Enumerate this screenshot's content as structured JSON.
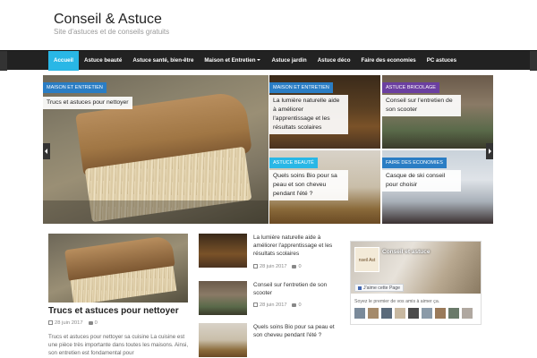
{
  "header": {
    "site_title": "Conseil & Astuce",
    "tagline": "Site d'astuces et de conseils gratuits"
  },
  "nav": {
    "items": [
      {
        "label": "Accueil",
        "active": true
      },
      {
        "label": "Astuce beauté"
      },
      {
        "label": "Astuce santé, bien-être"
      },
      {
        "label": "Maison et Entretien",
        "dropdown": true
      },
      {
        "label": "Astuce jardin"
      },
      {
        "label": "Astuce déco"
      },
      {
        "label": "Faire des economies"
      },
      {
        "label": "PC astuces"
      }
    ]
  },
  "slider": {
    "big": {
      "category": "Maison et entretien",
      "title": "Trucs et astuces pour nettoyer"
    },
    "s1": {
      "category": "Maison et entretien",
      "title": "La lumière naturelle aide à améliorer l'apprentissage et les résultats scolaires"
    },
    "s2": {
      "category": "Astuce bricolage",
      "title": "Conseil sur l'entretien de son scooter"
    },
    "s3": {
      "category": "Astuce beauté",
      "title": "Quels soins Bio pour sa peau et son cheveu pendant l'été ?"
    },
    "s4": {
      "category": "Faire des economies",
      "title": "Casque de ski conseil pour choisir"
    }
  },
  "featured": {
    "title": "Trucs et astuces pour nettoyer",
    "date": "28 juin 2017",
    "comments": "0",
    "excerpt": "Trucs et astuces pour nettoyer sa cuisine La cuisine est une pièce très importante dans toutes les maisons. Ainsi, son entretien est fondamental pour"
  },
  "list_posts": [
    {
      "title": "La lumière naturelle aide à améliorer l'apprentissage et les résultats scolaires",
      "date": "28 juin 2017",
      "comments": "0"
    },
    {
      "title": "Conseil sur l'entretien de son scooter",
      "date": "28 juin 2017",
      "comments": "0"
    },
    {
      "title": "Quels soins Bio pour sa peau et son cheveu pendant l'été ?",
      "date": "",
      "comments": ""
    }
  ],
  "facebook": {
    "page_name": "Conseil et astuce",
    "avatar_text": "nseil Ast",
    "like_label": "J'aime cette Page",
    "friends_text": "Soyez le premier de vos amis à aimer ça."
  },
  "colors": {
    "accent": "#29b7e6",
    "nav_bg": "#222222",
    "cat_blue": "#2a7dc4",
    "cat_purple": "#6b3fa0",
    "facebook": "#4267b2"
  }
}
